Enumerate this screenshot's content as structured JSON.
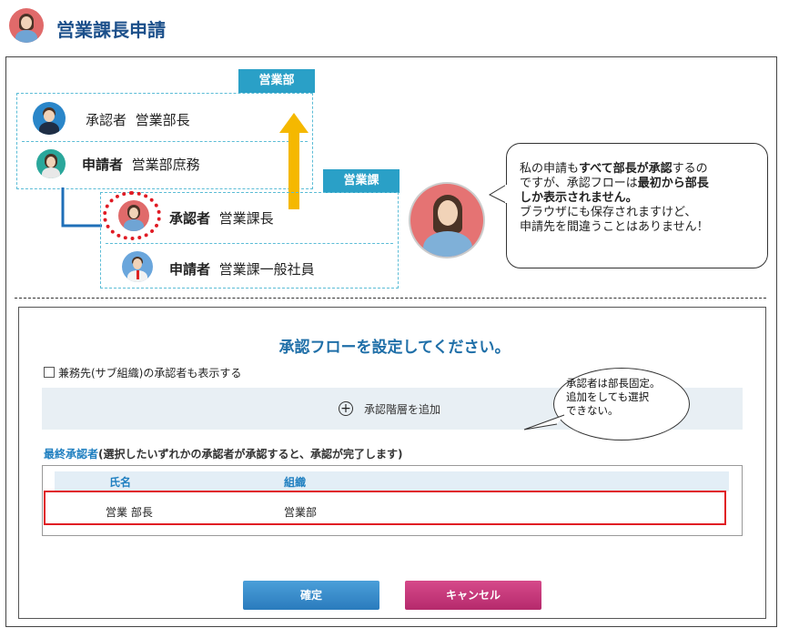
{
  "page": {
    "title": "営業課長申請"
  },
  "org_diagram": {
    "sales_dept_tag": "営業部",
    "sales_section_tag": "営業課",
    "dept_rows": [
      {
        "role": "承認者",
        "name": "営業部長"
      },
      {
        "role": "申請者",
        "name": "営業部庶務"
      }
    ],
    "section_rows": [
      {
        "role": "承認者",
        "name": "営業課長"
      },
      {
        "role": "申請者",
        "name": "営業課一般社員"
      }
    ]
  },
  "speech_bubble": {
    "lines": [
      {
        "parts": [
          {
            "t": "私の申請も",
            "b": false
          },
          {
            "t": "すべて部長が承認",
            "b": true
          },
          {
            "t": "するの",
            "b": false
          }
        ]
      },
      {
        "parts": [
          {
            "t": "ですが、承認フローは",
            "b": false
          },
          {
            "t": "最初から部長",
            "b": true
          }
        ]
      },
      {
        "parts": [
          {
            "t": "しか表示されません。",
            "b": true
          }
        ]
      },
      {
        "parts": [
          {
            "t": "ブラウザにも保存されますけど、",
            "b": false
          }
        ]
      },
      {
        "parts": [
          {
            "t": "申請先を間違うことはありません！",
            "b": false
          }
        ]
      }
    ]
  },
  "dialog": {
    "title": "承認フローを設定してください。",
    "checkbox_label": "兼務先(サブ組織)の承認者も表示する",
    "add_level_label": "承認階層を追加",
    "final_label_prefix": "最終承認者",
    "final_label_suffix": "(選択したいずれかの承認者が承認すると、承認が完了します)",
    "table": {
      "headers": [
        "氏名",
        "組織"
      ],
      "rows": [
        [
          "営業 部長",
          "営業部"
        ]
      ]
    },
    "callout": [
      "承認者は部長固定。",
      "追加をしても選択",
      "できない。"
    ],
    "confirm_label": "確定",
    "cancel_label": "キャンセル"
  },
  "colors": {
    "accent": "#2aa0c7",
    "title": "#1b4f8a",
    "arrow": "#f5b800",
    "highlight": "#e01b24",
    "confirm": "#2a7bbd",
    "cancel": "#b52a6c"
  }
}
